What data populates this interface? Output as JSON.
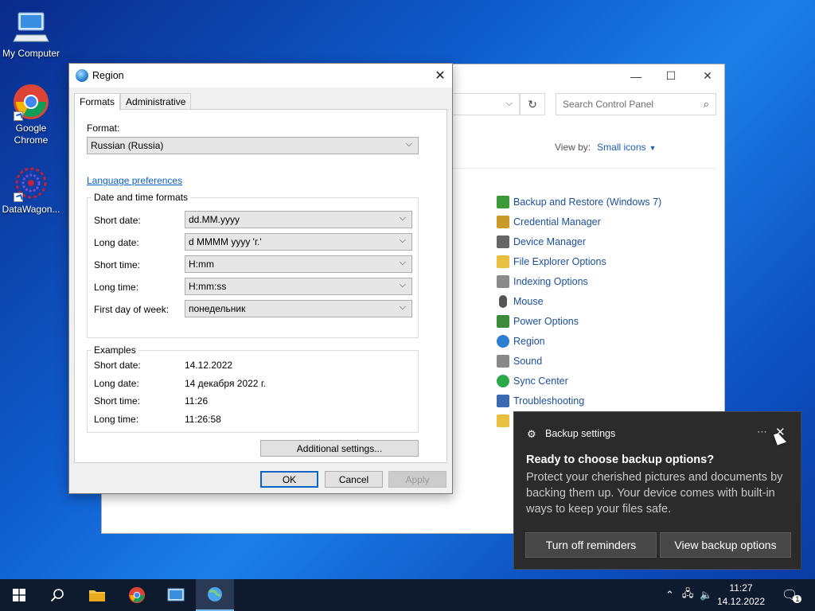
{
  "desktop": {
    "icons": [
      {
        "label": "My Computer",
        "icon": "computer-icon"
      },
      {
        "label": "Google Chrome",
        "icon": "chrome-icon"
      },
      {
        "label": "DataWagon...",
        "icon": "datawagon-icon"
      }
    ]
  },
  "control_panel": {
    "search_placeholder": "Search Control Panel",
    "view_by_label": "View by:",
    "view_by_value": "Small icons",
    "items": [
      {
        "label": "Backup and Restore (Windows 7)",
        "color": "#3a9a3a"
      },
      {
        "label": "Credential Manager",
        "color": "#c89a2a"
      },
      {
        "label": "Device Manager",
        "color": "#666666"
      },
      {
        "label": "File Explorer Options",
        "color": "#e8c040"
      },
      {
        "label": "Indexing Options",
        "color": "#8a8a8a"
      },
      {
        "label": "Mouse",
        "color": "#555555"
      },
      {
        "label": "Power Options",
        "color": "#3a8a3a"
      },
      {
        "label": "Region",
        "color": "#2a7fd0"
      },
      {
        "label": "Sound",
        "color": "#888888"
      },
      {
        "label": "Sync Center",
        "color": "#2aa84a"
      },
      {
        "label": "Troubleshooting",
        "color": "#3a6ab0"
      }
    ]
  },
  "region": {
    "title": "Region",
    "tabs": [
      "Formats",
      "Administrative"
    ],
    "format_label": "Format:",
    "format_value": "Russian (Russia)",
    "language_link": "Language preferences",
    "datetime_group": "Date and time formats",
    "fields": [
      {
        "label": "Short date:",
        "value": "dd.MM.yyyy"
      },
      {
        "label": "Long date:",
        "value": "d MMMM yyyy 'г.'"
      },
      {
        "label": "Short time:",
        "value": "H:mm"
      },
      {
        "label": "Long time:",
        "value": "H:mm:ss"
      },
      {
        "label": "First day of week:",
        "value": "понедельник"
      }
    ],
    "examples_group": "Examples",
    "examples": [
      {
        "label": "Short date:",
        "value": "14.12.2022"
      },
      {
        "label": "Long date:",
        "value": "14 декабря 2022 г."
      },
      {
        "label": "Short time:",
        "value": "11:26"
      },
      {
        "label": "Long time:",
        "value": "11:26:58"
      }
    ],
    "additional_settings": "Additional settings...",
    "ok": "OK",
    "cancel": "Cancel",
    "apply": "Apply"
  },
  "toast": {
    "app_name": "Backup settings",
    "heading": "Ready to choose backup options?",
    "body": "Protect your cherished pictures and documents by backing them up. Your device comes with built-in ways to keep your files safe.",
    "btn_off": "Turn off reminders",
    "btn_view": "View backup options"
  },
  "taskbar": {
    "time": "11:27",
    "date": "14.12.2022",
    "notification_count": "1"
  }
}
